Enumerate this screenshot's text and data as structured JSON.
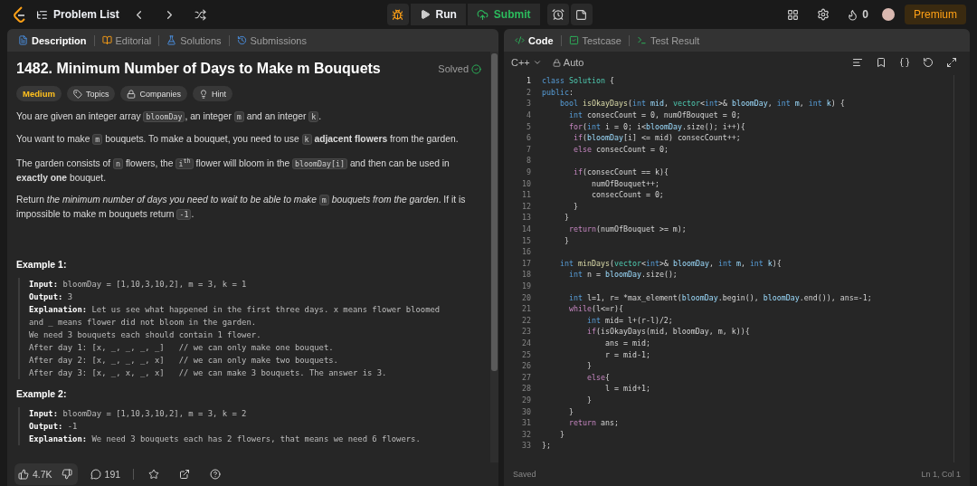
{
  "topbar": {
    "nav_title": "Problem List",
    "run_label": "Run",
    "submit_label": "Submit",
    "streak": "0",
    "premium": "Premium"
  },
  "left_tabs": [
    {
      "label": "Description",
      "selected": true,
      "kind": "doc"
    },
    {
      "label": "Editorial",
      "selected": false,
      "kind": "book"
    },
    {
      "label": "Solutions",
      "selected": false,
      "kind": "flask"
    },
    {
      "label": "Submissions",
      "selected": false,
      "kind": "history"
    }
  ],
  "problem": {
    "title": "1482. Minimum Number of Days to Make m Bouquets",
    "status": "Solved",
    "solved": true,
    "tags": [
      {
        "label": "Medium",
        "kind": "difficulty",
        "color": "#ffc01e"
      },
      {
        "label": "Topics",
        "kind": "tag"
      },
      {
        "label": "Companies",
        "kind": "lock"
      },
      {
        "label": "Hint",
        "kind": "bulb"
      }
    ],
    "paragraphs": [
      [
        {
          "kind": "text",
          "text": "You are given an integer array "
        },
        {
          "kind": "code",
          "text": "bloomDay"
        },
        {
          "kind": "text",
          "text": ", an integer "
        },
        {
          "kind": "code",
          "text": "m"
        },
        {
          "kind": "text",
          "text": " and an integer "
        },
        {
          "kind": "code",
          "text": "k"
        },
        {
          "kind": "text",
          "text": "."
        }
      ],
      [
        {
          "kind": "text",
          "text": "You want to make "
        },
        {
          "kind": "code",
          "text": "m"
        },
        {
          "kind": "text",
          "text": " bouquets. To make a bouquet, you need to use "
        },
        {
          "kind": "code",
          "text": "k"
        },
        {
          "kind": "text",
          "text": " **adjacent flowers** from the garden."
        }
      ],
      [
        {
          "kind": "text",
          "text": "The garden consists of "
        },
        {
          "kind": "code",
          "text": "n"
        },
        {
          "kind": "text",
          "text": " flowers, the "
        },
        {
          "kind": "code",
          "text": "i$^{th}$"
        },
        {
          "kind": "text",
          "text": " flower will bloom in the "
        },
        {
          "kind": "code",
          "text": "bloomDay[i]"
        },
        {
          "kind": "text",
          "text": " and then can be used in **exactly one** bouquet."
        }
      ],
      [
        {
          "kind": "text",
          "text": "Return "
        },
        {
          "kind": "em",
          "text": "the minimum number of days you need to wait to be able to make "
        },
        {
          "kind": "code",
          "text": "m"
        },
        {
          "kind": "em",
          "text": " bouquets from the garden"
        },
        {
          "kind": "text",
          "text": ". If it is impossible to make m bouquets return "
        },
        {
          "kind": "code",
          "text": "-1"
        },
        {
          "kind": "text",
          "text": "."
        }
      ]
    ],
    "examples": [
      {
        "title": "Example 1:",
        "lines": [
          "**Input:** bloomDay = [1,10,3,10,2], m = 3, k = 1",
          "**Output:** 3",
          "**Explanation:** Let us see what happened in the first three days. x means flower bloomed and _ means flower did not bloom in the garden.",
          "We need 3 bouquets each should contain 1 flower.",
          "After day 1: [x, _, _, _, _]   // we can only make one bouquet.",
          "After day 2: [x, _, _, _, x]   // we can only make two bouquets.",
          "After day 3: [x, _, x, _, x]   // we can make 3 bouquets. The answer is 3."
        ]
      },
      {
        "title": "Example 2:",
        "lines": [
          "**Input:** bloomDay = [1,10,3,10,2], m = 3, k = 2",
          "**Output:** -1",
          "**Explanation:** We need 3 bouquets each has 2 flowers, that means we need 6 flowers."
        ]
      }
    ]
  },
  "footer": {
    "likes": "4.7K",
    "comments": "191"
  },
  "right_tabs": [
    {
      "label": "Code",
      "selected": true,
      "kind": "code"
    },
    {
      "label": "Testcase",
      "selected": false,
      "kind": "check"
    },
    {
      "label": "Test Result",
      "selected": false,
      "kind": "terminal"
    }
  ],
  "editor": {
    "language": "C++",
    "mode": "Auto",
    "saved": "Saved",
    "cursor": "Ln 1, Col 1",
    "lines": [
      {
        "n": "1",
        "t": [
          {
            "kind": "kw",
            "text": "class "
          },
          {
            "kind": "ty",
            "text": "Solution"
          },
          {
            "kind": "p",
            "text": " {"
          }
        ]
      },
      {
        "n": "2",
        "t": [
          {
            "kind": "kw",
            "text": "public"
          },
          {
            "kind": "p",
            "text": ":"
          }
        ]
      },
      {
        "n": "3",
        "t": [
          {
            "kind": "kw",
            "text": "    bool "
          },
          {
            "kind": "fn",
            "text": "isOkayDays"
          },
          {
            "kind": "p",
            "text": "("
          },
          {
            "kind": "kw",
            "text": "int "
          },
          {
            "kind": "v",
            "text": "mid"
          },
          {
            "kind": "p",
            "text": ", "
          },
          {
            "kind": "ty",
            "text": "vector"
          },
          {
            "kind": "p",
            "text": "<"
          },
          {
            "kind": "kw",
            "text": "int"
          },
          {
            "kind": "p",
            "text": ">& "
          },
          {
            "kind": "v",
            "text": "bloomDay"
          },
          {
            "kind": "p",
            "text": ", "
          },
          {
            "kind": "kw",
            "text": "int "
          },
          {
            "kind": "v",
            "text": "m"
          },
          {
            "kind": "p",
            "text": ", "
          },
          {
            "kind": "kw",
            "text": "int "
          },
          {
            "kind": "v",
            "text": "k"
          },
          {
            "kind": "p",
            "text": ") {"
          }
        ]
      },
      {
        "n": "4",
        "t": [
          {
            "kind": "kw",
            "text": "      int "
          },
          {
            "kind": "p",
            "text": "consecCount = 0, numOfBouquet = 0;"
          }
        ]
      },
      {
        "n": "5",
        "t": [
          {
            "kind": "ct",
            "text": "      for"
          },
          {
            "kind": "p",
            "text": "("
          },
          {
            "kind": "kw",
            "text": "int "
          },
          {
            "kind": "p",
            "text": "i = 0; i<"
          },
          {
            "kind": "v",
            "text": "bloomDay"
          },
          {
            "kind": "p",
            "text": ".size(); i++){"
          }
        ]
      },
      {
        "n": "6",
        "t": [
          {
            "kind": "ct",
            "text": "       if"
          },
          {
            "kind": "p",
            "text": "("
          },
          {
            "kind": "v",
            "text": "bloomDay"
          },
          {
            "kind": "p",
            "text": "[i] <= mid) consecCount++;"
          }
        ]
      },
      {
        "n": "7",
        "t": [
          {
            "kind": "ct",
            "text": "       else "
          },
          {
            "kind": "p",
            "text": "consecCount = 0;"
          }
        ]
      },
      {
        "n": "8"
      },
      {
        "n": "9",
        "t": [
          {
            "kind": "ct",
            "text": "       if"
          },
          {
            "kind": "p",
            "text": "(consecCount == k){"
          }
        ]
      },
      {
        "n": "10",
        "t": [
          {
            "kind": "p",
            "text": "           numOfBouquet++;"
          }
        ]
      },
      {
        "n": "11",
        "t": [
          {
            "kind": "p",
            "text": "           consecCount = 0;"
          }
        ]
      },
      {
        "n": "12",
        "t": [
          {
            "kind": "p",
            "text": "       }"
          }
        ]
      },
      {
        "n": "13",
        "t": [
          {
            "kind": "p",
            "text": "     }"
          }
        ]
      },
      {
        "n": "14",
        "t": [
          {
            "kind": "ct",
            "text": "      return"
          },
          {
            "kind": "p",
            "text": "(numOfBouquet >= m);"
          }
        ]
      },
      {
        "n": "15",
        "t": [
          {
            "kind": "p",
            "text": "     }"
          }
        ]
      },
      {
        "n": "16"
      },
      {
        "n": "17",
        "t": [
          {
            "kind": "kw",
            "text": "    int "
          },
          {
            "kind": "fn",
            "text": "minDays"
          },
          {
            "kind": "p",
            "text": "("
          },
          {
            "kind": "ty",
            "text": "vector"
          },
          {
            "kind": "p",
            "text": "<"
          },
          {
            "kind": "kw",
            "text": "int"
          },
          {
            "kind": "p",
            "text": ">& "
          },
          {
            "kind": "v",
            "text": "bloomDay"
          },
          {
            "kind": "p",
            "text": ", "
          },
          {
            "kind": "kw",
            "text": "int "
          },
          {
            "kind": "v",
            "text": "m"
          },
          {
            "kind": "p",
            "text": ", "
          },
          {
            "kind": "kw",
            "text": "int "
          },
          {
            "kind": "v",
            "text": "k"
          },
          {
            "kind": "p",
            "text": "){"
          }
        ]
      },
      {
        "n": "18",
        "t": [
          {
            "kind": "kw",
            "text": "      int "
          },
          {
            "kind": "p",
            "text": "n = "
          },
          {
            "kind": "v",
            "text": "bloomDay"
          },
          {
            "kind": "p",
            "text": ".size();"
          }
        ]
      },
      {
        "n": "19"
      },
      {
        "n": "20",
        "t": [
          {
            "kind": "kw",
            "text": "      int "
          },
          {
            "kind": "p",
            "text": "l=1, r= *max_element("
          },
          {
            "kind": "v",
            "text": "bloomDay"
          },
          {
            "kind": "p",
            "text": ".begin(), "
          },
          {
            "kind": "v",
            "text": "bloomDay"
          },
          {
            "kind": "p",
            "text": ".end()), ans=-1;"
          }
        ]
      },
      {
        "n": "21",
        "t": [
          {
            "kind": "ct",
            "text": "      while"
          },
          {
            "kind": "p",
            "text": "(l<=r){"
          }
        ]
      },
      {
        "n": "22",
        "t": [
          {
            "kind": "kw",
            "text": "          int "
          },
          {
            "kind": "p",
            "text": "mid= l+(r-l)/2;"
          }
        ]
      },
      {
        "n": "23",
        "t": [
          {
            "kind": "ct",
            "text": "          if"
          },
          {
            "kind": "p",
            "text": "(isOkayDays(mid, bloomDay, m, k)){"
          }
        ]
      },
      {
        "n": "24",
        "t": [
          {
            "kind": "p",
            "text": "              ans = mid;"
          }
        ]
      },
      {
        "n": "25",
        "t": [
          {
            "kind": "p",
            "text": "              r = mid-1;"
          }
        ]
      },
      {
        "n": "26",
        "t": [
          {
            "kind": "p",
            "text": "          }"
          }
        ]
      },
      {
        "n": "27",
        "t": [
          {
            "kind": "ct",
            "text": "          else"
          },
          {
            "kind": "p",
            "text": "{"
          }
        ]
      },
      {
        "n": "28",
        "t": [
          {
            "kind": "p",
            "text": "              l = mid+1;"
          }
        ]
      },
      {
        "n": "29",
        "t": [
          {
            "kind": "p",
            "text": "          }"
          }
        ]
      },
      {
        "n": "30",
        "t": [
          {
            "kind": "p",
            "text": "      }"
          }
        ]
      },
      {
        "n": "31",
        "t": [
          {
            "kind": "ct",
            "text": "      return "
          },
          {
            "kind": "p",
            "text": "ans;"
          }
        ]
      },
      {
        "n": "32",
        "t": [
          {
            "kind": "p",
            "text": "    }"
          }
        ]
      },
      {
        "n": "33",
        "t": [
          {
            "kind": "p",
            "text": "};"
          }
        ]
      }
    ]
  }
}
